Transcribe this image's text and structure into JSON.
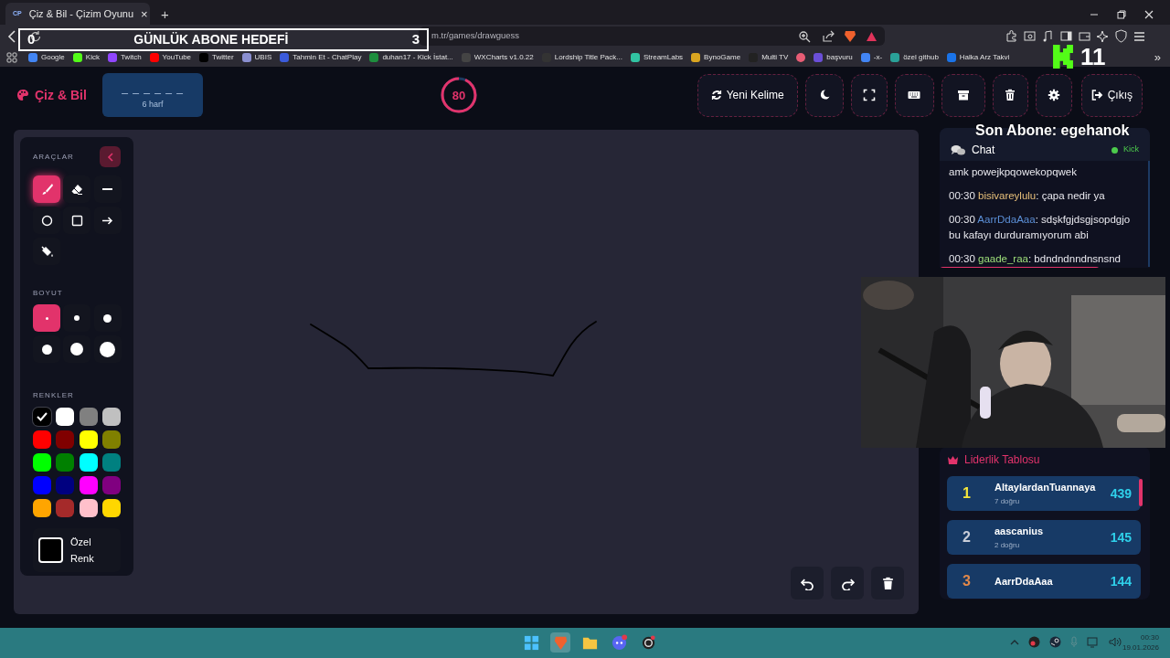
{
  "browser": {
    "tab": {
      "favicon": "CP",
      "title": "Çiz & Bil - Çizim Oyunu",
      "close": "×"
    },
    "new_tab": "+",
    "url": "m.tr/games/drawguess",
    "bookmarks": [
      {
        "label": "Google",
        "color": "#4285f4"
      },
      {
        "label": "Kick",
        "color": "#53fc18"
      },
      {
        "label": "Twitch",
        "color": "#9146ff"
      },
      {
        "label": "YouTube",
        "color": "#ff0000"
      },
      {
        "label": "Twitter",
        "color": "#000000"
      },
      {
        "label": "UBIS",
        "color": "#8a8fd0"
      },
      {
        "label": "Tahmin Et - ChatPlay",
        "color": "#3b5bdb"
      },
      {
        "label": "duhan17 - Kick İstat...",
        "color": "#1e8e3e"
      },
      {
        "label": "WXCharts v1.0.22",
        "color": "#444444"
      },
      {
        "label": "Lordship Title Pack...",
        "color": "#333333"
      },
      {
        "label": "StreamLabs",
        "color": "#31c3a2"
      },
      {
        "label": "BynoGame",
        "color": "#d9a520"
      },
      {
        "label": "Multi TV",
        "color": "#222222"
      },
      {
        "color": "#e85d75"
      },
      {
        "label": "başvuru",
        "color": "#6b4fd8"
      },
      {
        "label": "-x-",
        "color": "#4285f4"
      },
      {
        "label": "özel github",
        "color": "#2aa198"
      },
      {
        "label": "Halka Arz Takvi",
        "color": "#1a73e8"
      }
    ],
    "more": "»"
  },
  "overlays": {
    "goal": {
      "current": "0",
      "label": "GÜNLÜK ABONE HEDEFİ",
      "target": "3"
    },
    "kick_count": "11",
    "last_sub": "Son Abone: egehanok"
  },
  "header": {
    "logo": "Çiz & Bil",
    "word": {
      "blanks": "_ _ _ _ _ _",
      "hint": "6 harf"
    },
    "timer": {
      "value": "80",
      "level": 0.93
    },
    "new_word": "Yeni Kelime",
    "exit": "Çıkış"
  },
  "tools": {
    "title": "ARAÇLAR",
    "items": [
      {
        "selected": true
      },
      {
        "selected": false
      },
      {
        "selected": false
      },
      {
        "selected": false
      },
      {
        "selected": false
      },
      {
        "selected": false
      },
      {
        "selected": false
      }
    ],
    "size_title": "BOYUT",
    "sizes": [
      {
        "selected": true
      },
      {
        "selected": false
      },
      {
        "selected": false
      },
      {
        "selected": false
      },
      {
        "selected": false
      },
      {
        "selected": false
      }
    ],
    "color_title": "RENKLER",
    "colors": [
      {
        "color": "#000000",
        "selected": true
      },
      {
        "color": "#ffffff",
        "selected": false
      },
      {
        "color": "#808080",
        "selected": false
      },
      {
        "color": "#c0c0c0",
        "selected": false
      },
      {
        "color": "#ff0000",
        "selected": false
      },
      {
        "color": "#800000",
        "selected": false
      },
      {
        "color": "#ffff00",
        "selected": false
      },
      {
        "color": "#808000",
        "selected": false
      },
      {
        "color": "#00ff00",
        "selected": false
      },
      {
        "color": "#008000",
        "selected": false
      },
      {
        "color": "#00ffff",
        "selected": false
      },
      {
        "color": "#008080",
        "selected": false
      },
      {
        "color": "#0000ff",
        "selected": false
      },
      {
        "color": "#000080",
        "selected": false
      },
      {
        "color": "#ff00ff",
        "selected": false
      },
      {
        "color": "#800080",
        "selected": false
      },
      {
        "color": "#ffa500",
        "selected": false
      },
      {
        "color": "#a52a2a",
        "selected": false
      },
      {
        "color": "#ffc0cb",
        "selected": false
      },
      {
        "color": "#ffd700",
        "selected": false
      }
    ],
    "custom": {
      "label": "Özel Renk",
      "color": "#000000"
    }
  },
  "chat": {
    "title": "Chat",
    "source": "Kick",
    "messages": [
      {
        "text": "amk powejkpqowekopqwek"
      },
      {
        "time": "00:30",
        "user": "bisivareylulu",
        "color": "#e8c07a",
        "separator": ":",
        "text": "çapa nedir ya"
      },
      {
        "time": "00:30",
        "user": "AarrDdaAaa",
        "color": "#5b8fd6",
        "separator": ":",
        "text": "sdşkfgjdsgjsopdgjo bu kafayı durduramıyorum abi"
      },
      {
        "time": "00:30",
        "user": "gaade_raa",
        "color": "#9ee07a",
        "separator": ":",
        "text": "bdndndnndnsnsnd"
      }
    ]
  },
  "leaderboard": {
    "title": "Liderlik Tablosu",
    "entries": [
      {
        "rank": "1",
        "color": "#f5e63b",
        "name": "AltaylardanTuannaya",
        "correct": "7 doğru",
        "score": "439"
      },
      {
        "rank": "2",
        "color": "#c8cdd8",
        "name": "aascanius",
        "correct": "2 doğru",
        "score": "145"
      },
      {
        "rank": "3",
        "color": "#e0884a",
        "name": "AarrDdaAaa",
        "score": "144"
      }
    ]
  },
  "taskbar": {
    "time": "00:30",
    "date": "19.01.2026"
  }
}
